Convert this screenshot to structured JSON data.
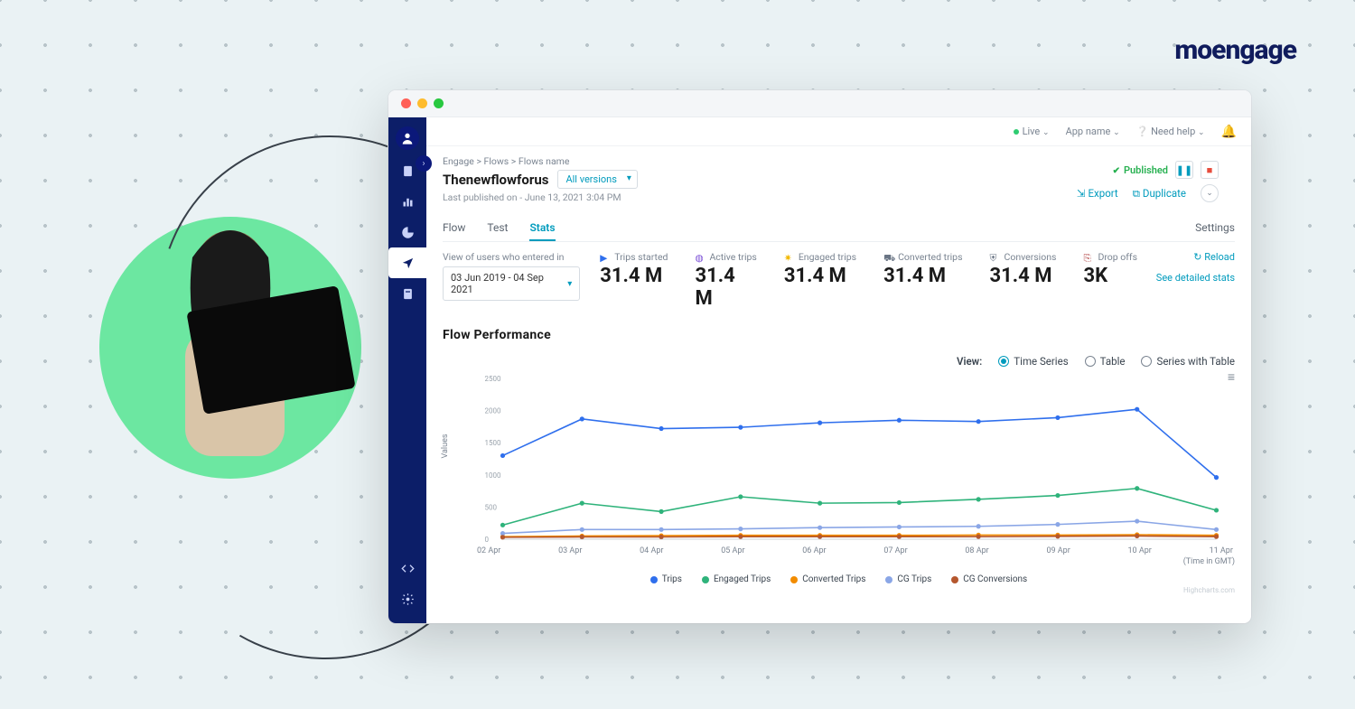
{
  "brand": "moengage",
  "topbar": {
    "live": "Live",
    "app": "App name",
    "help": "Need help"
  },
  "breadcrumbs": "Engage > Flows > Flows name",
  "flow": {
    "title": "Thenewflowforus",
    "version_dd": "All versions",
    "meta": "Last published on - June 13, 2021 3:04 PM",
    "status": "Published",
    "export": "Export",
    "duplicate": "Duplicate"
  },
  "tabs": {
    "flow": "Flow",
    "test": "Test",
    "stats": "Stats",
    "settings": "Settings"
  },
  "kpi": {
    "view_label": "View of users who entered in",
    "date_range": "03 Jun 2019 - 04 Sep 2021",
    "items": [
      {
        "label": "Trips started",
        "value": "31.4 M",
        "color": "#2f6fed",
        "glyph": "▶"
      },
      {
        "label": "Active trips",
        "value": "31.4 M",
        "color": "#7b4fd6",
        "glyph": "◍"
      },
      {
        "label": "Engaged trips",
        "value": "31.4 M",
        "color": "#f2b800",
        "glyph": "✷"
      },
      {
        "label": "Converted trips",
        "value": "31.4 M",
        "color": "#6a7585",
        "glyph": "⛟"
      },
      {
        "label": "Conversions",
        "value": "31.4 M",
        "color": "#6a7585",
        "glyph": "⛨"
      },
      {
        "label": "Drop offs",
        "value": "3K",
        "color": "#b44a4a",
        "glyph": "⎘"
      }
    ],
    "reload": "Reload",
    "see_detail": "See detailed stats"
  },
  "chart": {
    "title": "Flow  Performance",
    "view_label": "View:",
    "opts": {
      "ts": "Time Series",
      "tbl": "Table",
      "swt": "Series with Table"
    },
    "ylabel": "Values",
    "xnote": "(Time in GMT)",
    "attrib": "Highcharts.com",
    "legend": [
      {
        "name": "Trips",
        "color": "#2f6fed"
      },
      {
        "name": "Engaged Trips",
        "color": "#2fb37b"
      },
      {
        "name": "Converted Trips",
        "color": "#f28c00"
      },
      {
        "name": "CG Trips",
        "color": "#8aa6e6"
      },
      {
        "name": "CG Conversions",
        "color": "#b5572e"
      }
    ]
  },
  "chart_data": {
    "type": "line",
    "x": [
      "02 Apr",
      "03 Apr",
      "04 Apr",
      "05 Apr",
      "06 Apr",
      "07 Apr",
      "08 Apr",
      "09 Apr",
      "10 Apr",
      "11 Apr"
    ],
    "ylim": [
      0,
      2500
    ],
    "ylabel": "Values",
    "xlabel": "(Time in GMT)",
    "series": [
      {
        "name": "Trips",
        "color": "#2f6fed",
        "values": [
          1300,
          1870,
          1720,
          1740,
          1810,
          1850,
          1830,
          1890,
          2020,
          960
        ]
      },
      {
        "name": "Engaged Trips",
        "color": "#2fb37b",
        "values": [
          220,
          560,
          430,
          660,
          560,
          570,
          620,
          680,
          790,
          450
        ]
      },
      {
        "name": "Converted Trips",
        "color": "#f28c00",
        "values": [
          40,
          50,
          55,
          60,
          60,
          60,
          65,
          65,
          70,
          60
        ]
      },
      {
        "name": "CG Trips",
        "color": "#8aa6e6",
        "values": [
          90,
          150,
          150,
          160,
          180,
          190,
          200,
          230,
          280,
          150
        ]
      },
      {
        "name": "CG Conversions",
        "color": "#b5572e",
        "values": [
          30,
          35,
          35,
          40,
          40,
          40,
          40,
          45,
          50,
          40
        ]
      }
    ]
  }
}
